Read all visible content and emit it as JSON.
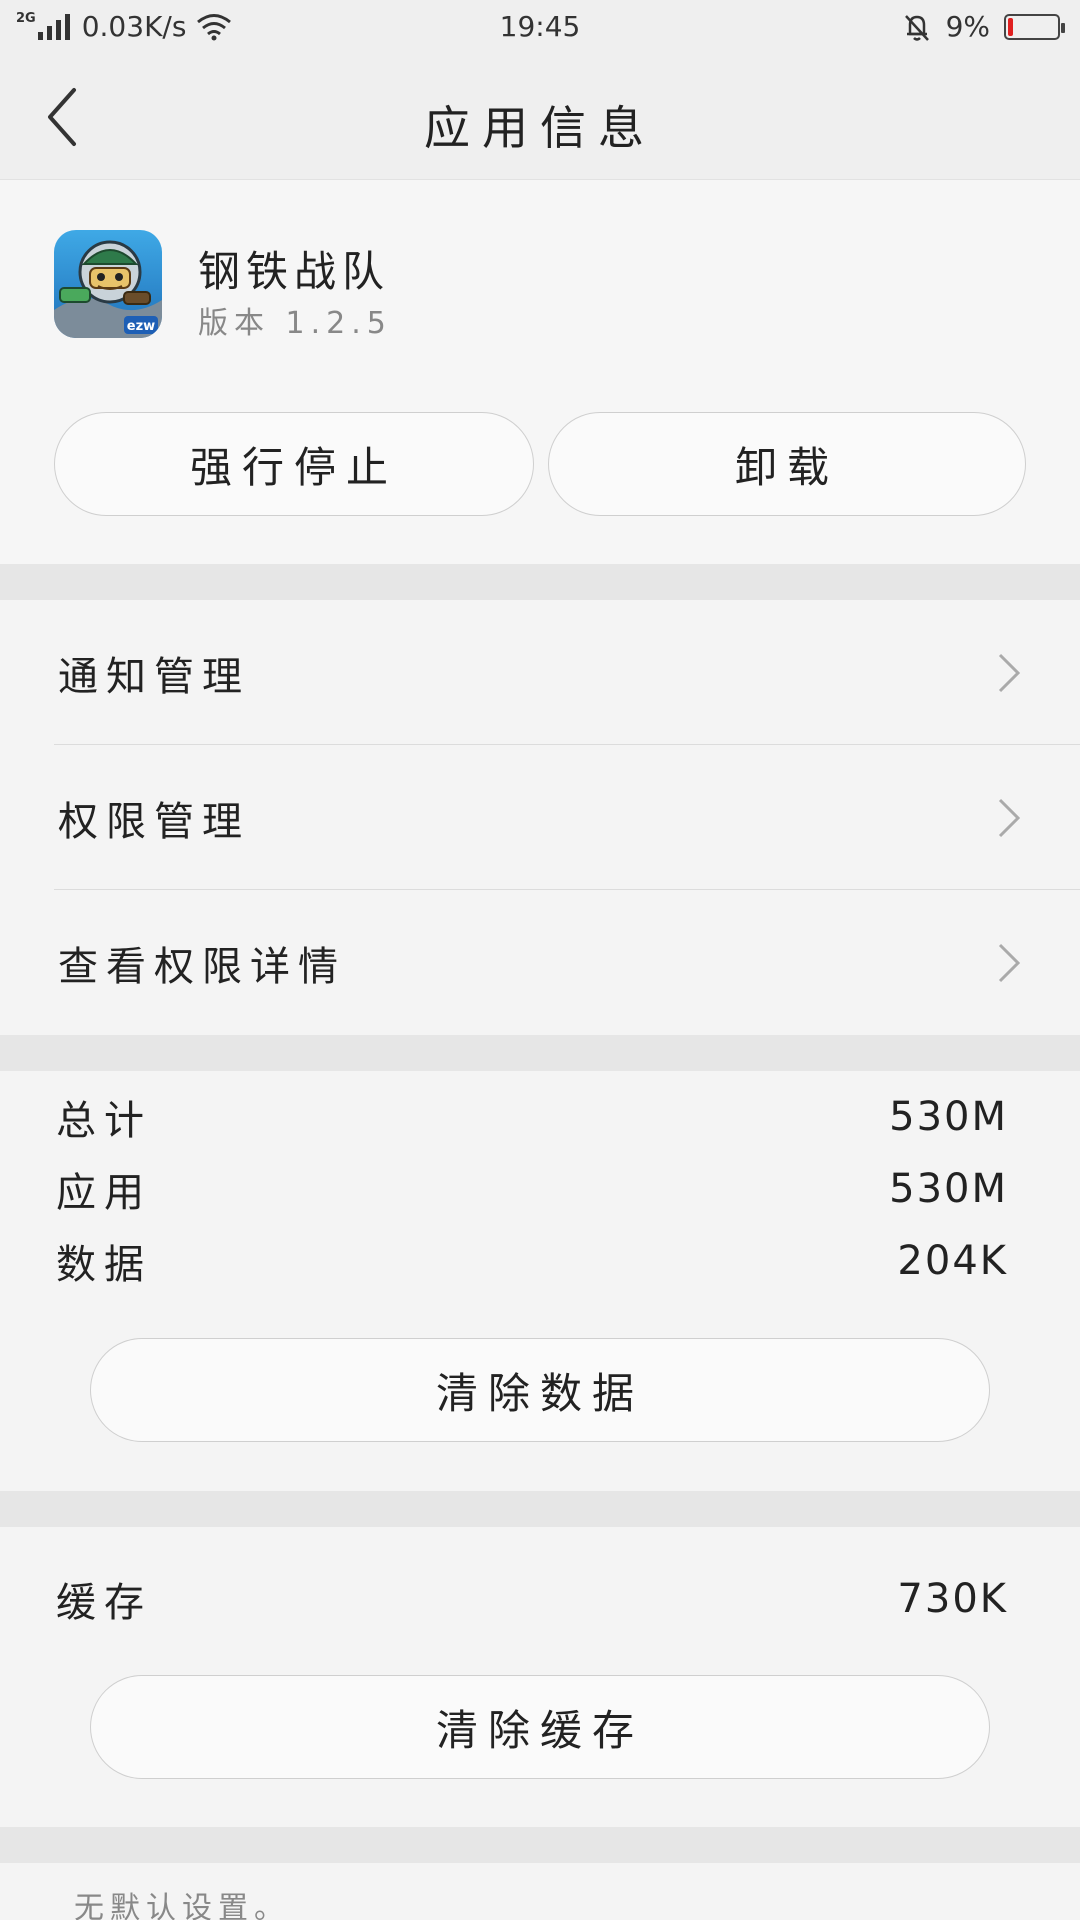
{
  "status_bar": {
    "network_type": "2G",
    "speed": "0.03K/s",
    "time": "19:45",
    "battery_percent": "9%",
    "battery_level": 0.09,
    "battery_color": "#e02020"
  },
  "header": {
    "title": "应用信息",
    "back_icon": "chevron-left-icon"
  },
  "app": {
    "name": "钢铁战队",
    "version": "版本 1.2.5",
    "icon_badge": "ezw",
    "buttons": {
      "force_stop": "强行停止",
      "uninstall": "卸载"
    }
  },
  "menu": {
    "items": [
      {
        "label": "通知管理",
        "icon": "chevron-right-icon"
      },
      {
        "label": "权限管理",
        "icon": "chevron-right-icon"
      },
      {
        "label": "查看权限详情",
        "icon": "chevron-right-icon"
      }
    ]
  },
  "storage": {
    "rows": [
      {
        "label": "总计",
        "value": "530M"
      },
      {
        "label": "应用",
        "value": "530M"
      },
      {
        "label": "数据",
        "value": "204K"
      }
    ],
    "clear_data_label": "清除数据"
  },
  "cache": {
    "label": "缓存",
    "value": "730K",
    "clear_cache_label": "清除缓存"
  },
  "defaults": {
    "text": "无默认设置。"
  }
}
